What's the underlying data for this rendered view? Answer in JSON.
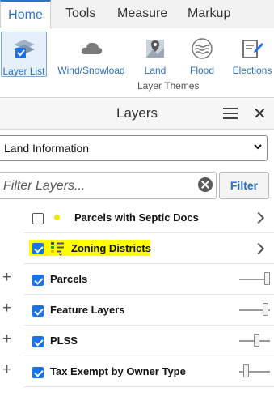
{
  "tabs": [
    {
      "label": "Home",
      "active": true
    },
    {
      "label": "Tools",
      "active": false
    },
    {
      "label": "Measure",
      "active": false
    },
    {
      "label": "Markup",
      "active": false
    }
  ],
  "ribbon": {
    "buttons": [
      {
        "label": "Layer List",
        "icon": "layer-list-icon",
        "selected": true
      },
      {
        "label": "Wind/Snowload",
        "icon": "cloud-icon",
        "selected": false
      },
      {
        "label": "Land",
        "icon": "map-pin-icon",
        "selected": false
      },
      {
        "label": "Flood",
        "icon": "flood-icon",
        "selected": false
      },
      {
        "label": "Elections",
        "icon": "ballot-icon",
        "selected": false
      }
    ],
    "group_label": "Layer Themes"
  },
  "panel": {
    "title": "Layers",
    "select_value": "Land Information",
    "filter_placeholder": "Filter Layers...",
    "filter_button": "Filter"
  },
  "layers": [
    {
      "name": "Parcels with Septic Docs",
      "checked": false,
      "legend": "yellow-dot-icon",
      "has_arrow": true,
      "expandable": false
    },
    {
      "name": "Zoning Districts",
      "checked": true,
      "legend": "legend-list-icon",
      "has_arrow": true,
      "highlighted": true,
      "expandable": false
    },
    {
      "name": "Parcels",
      "checked": true,
      "expandable": true,
      "opacity": 1.0
    },
    {
      "name": "Feature Layers",
      "checked": true,
      "expandable": true,
      "opacity": 0.95
    },
    {
      "name": "PLSS",
      "checked": true,
      "expandable": true,
      "opacity": 0.6
    },
    {
      "name": "Tax Exempt by Owner Type",
      "checked": true,
      "expandable": true,
      "opacity": 0.2
    }
  ],
  "colors": {
    "accent": "#2b74c7",
    "checkbox": "#1a73e8",
    "highlight": "#ffff00"
  }
}
